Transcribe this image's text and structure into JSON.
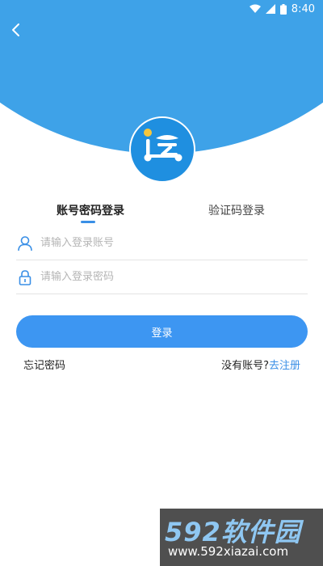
{
  "status_bar": {
    "time": "8:40",
    "icons": [
      "wifi-icon",
      "signal-icon",
      "battery-icon"
    ]
  },
  "nav": {
    "back_icon": "chevron-left-icon"
  },
  "logo": {
    "icon": "app-logo-icon"
  },
  "tabs": [
    {
      "label": "账号密码登录",
      "active": true
    },
    {
      "label": "验证码登录",
      "active": false
    }
  ],
  "form": {
    "account": {
      "placeholder": "请输入登录账号",
      "value": "",
      "icon": "user-icon"
    },
    "password": {
      "placeholder": "请输入登录密码",
      "value": "",
      "icon": "lock-icon"
    },
    "login_label": "登录"
  },
  "links": {
    "forgot": "忘记密码",
    "no_account": "没有账号?",
    "register": "去注册"
  },
  "watermark": {
    "title": "592软件园",
    "url": "www.592xiazai.com"
  },
  "colors": {
    "header": "#3ea2e8",
    "accent": "#3d96f2",
    "link": "#3a8fe6"
  }
}
